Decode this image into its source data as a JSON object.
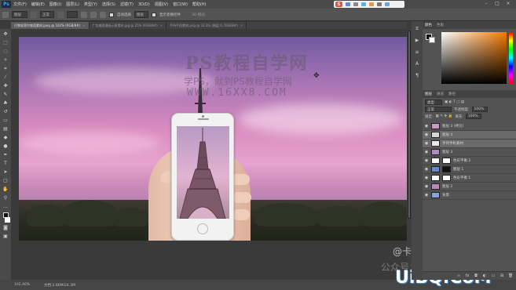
{
  "app": {
    "logo": "Ps",
    "menu": [
      "文件(F)",
      "编辑(E)",
      "图像(I)",
      "图层(L)",
      "类型(Y)",
      "选择(S)",
      "滤镜(T)",
      "3D(D)",
      "视图(V)",
      "窗口(W)",
      "帮助(H)"
    ],
    "ime_logo": "S"
  },
  "options": {
    "tool_preset": "图层",
    "mode": "正常",
    "auto_select_label": "自动选择",
    "auto_select_target": "图层",
    "transform_label": "显示变换控件",
    "mode_3d": "3D 模式:"
  },
  "tabs": [
    {
      "label": "巴黎埃菲尔铁塔素材.jpeg @ 102% (RGB/8#)",
      "active": true
    },
    {
      "label": "广告美图漫画示意素材.jpg @ 25% (RGB/8#)",
      "active": false
    },
    {
      "label": "手持手机素材.png @ 33.3% (图层 0, RGB/8#)",
      "active": false
    }
  ],
  "canvas": {
    "watermark_title": "PS教程自学网",
    "watermark_sub": "学PS，就到PS教程自学网",
    "watermark_url": "WWW.16XX8.COM"
  },
  "overlay": {
    "weibo": "@卡乐筠",
    "gzh": "公众号：卡乐筠",
    "site": "UiBQ.CoM"
  },
  "status": {
    "zoom": "102.46%",
    "doc": "文档:2.86M/24.3M"
  },
  "panels": {
    "color_tabs": [
      "颜色",
      "色板"
    ],
    "layer_tabs": [
      "图层",
      "通道",
      "路径"
    ],
    "kind_label": "类型",
    "blend_mode": "正常",
    "opacity_label": "不透明度:",
    "opacity_value": "100%",
    "lock_label": "锁定:",
    "fill_label": "填充:",
    "fill_value": "100%"
  },
  "layers": [
    {
      "name": "图层 3 (拷贝)",
      "selected": false,
      "thumb": "#c89ac0",
      "mask": null
    },
    {
      "name": "图层 4",
      "selected": true,
      "thumb": "#d7d7d7",
      "mask": null
    },
    {
      "name": "手持手机素材",
      "selected": true,
      "thumb": "#e9e9e9",
      "mask": null
    },
    {
      "name": "图层 3",
      "selected": false,
      "thumb": "#b08bc0",
      "mask": null
    },
    {
      "name": "色彩平衡 2",
      "selected": false,
      "thumb": "#ffffff",
      "mask": "#ffffff"
    },
    {
      "name": "图层 1",
      "selected": false,
      "thumb": "#6a88c8",
      "mask": "#111111"
    },
    {
      "name": "色彩平衡 1",
      "selected": false,
      "thumb": "#ffffff",
      "mask": "#ffffff"
    },
    {
      "name": "图层 2",
      "selected": false,
      "thumb": "#b68bb8",
      "mask": null
    },
    {
      "name": "背景",
      "selected": false,
      "thumb": "#8aa0d8",
      "mask": null
    }
  ]
}
